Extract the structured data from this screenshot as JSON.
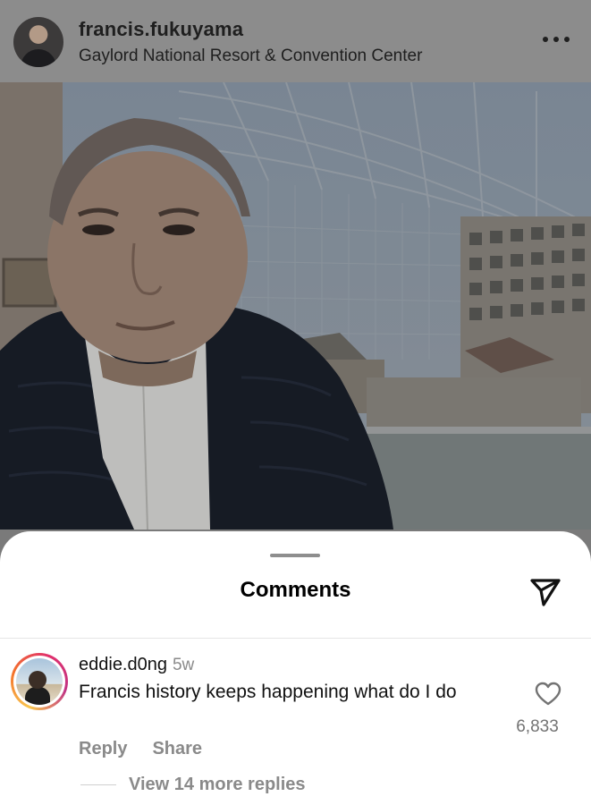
{
  "post": {
    "username": "francis.fukuyama",
    "location": "Gaylord National Resort & Convention Center",
    "more_icon": "more-horizontal-icon"
  },
  "comments_sheet": {
    "title": "Comments",
    "share_icon": "send-icon"
  },
  "comments": [
    {
      "username": "eddie.d0ng",
      "time": "5w",
      "text": "Francis history keeps happening what do I do",
      "likes": "6,833",
      "reply_label": "Reply",
      "share_label": "Share",
      "view_replies": "View 14 more replies"
    }
  ],
  "colors": {
    "overlay_dim": "#8c8c8c",
    "sheet_bg": "#ffffff",
    "secondary_text": "#8a8a8a"
  }
}
